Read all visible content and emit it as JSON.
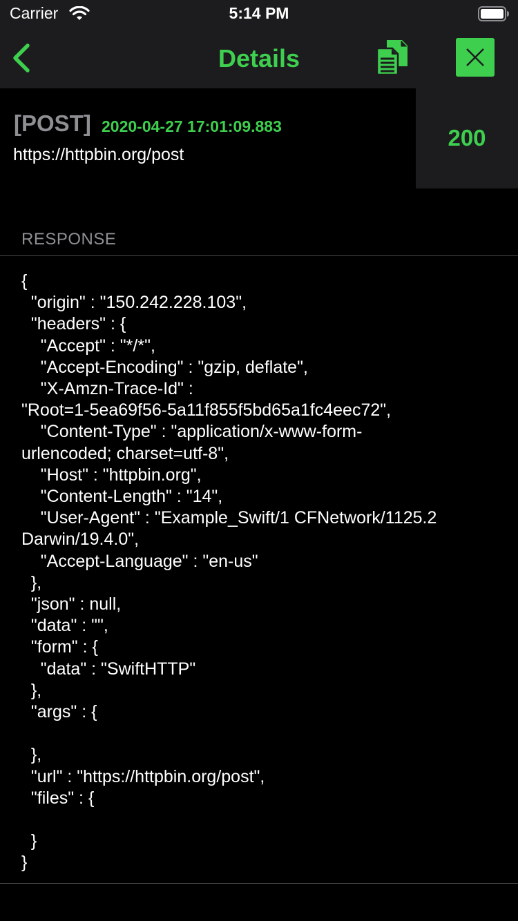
{
  "status_bar": {
    "carrier": "Carrier",
    "time": "5:14 PM"
  },
  "nav": {
    "title": "Details",
    "back_icon": "chevron-left-icon",
    "copy_icon": "copy-documents-icon",
    "close_icon": "close-x-icon"
  },
  "request": {
    "method": "[POST]",
    "timestamp": "2020-04-27 17:01:09.883",
    "url": "https://httpbin.org/post",
    "status_code": "200"
  },
  "response": {
    "section_title": "RESPONSE",
    "body": "{\n  \"origin\" : \"150.242.228.103\",\n  \"headers\" : {\n    \"Accept\" : \"*/*\",\n    \"Accept-Encoding\" : \"gzip, deflate\",\n    \"X-Amzn-Trace-Id\" :\n\"Root=1-5ea69f56-5a11f855f5bd65a1fc4eec72\",\n    \"Content-Type\" : \"application/x-www-form-\nurlencoded; charset=utf-8\",\n    \"Host\" : \"httpbin.org\",\n    \"Content-Length\" : \"14\",\n    \"User-Agent\" : \"Example_Swift/1 CFNetwork/1125.2\nDarwin/19.4.0\",\n    \"Accept-Language\" : \"en-us\"\n  },\n  \"json\" : null,\n  \"data\" : \"\",\n  \"form\" : {\n    \"data\" : \"SwiftHTTP\"\n  },\n  \"args\" : {\n\n  },\n  \"url\" : \"https://httpbin.org/post\",\n  \"files\" : {\n\n  }\n}"
  },
  "colors": {
    "accent": "#3ecf4f",
    "bar_background": "#1c1c1e",
    "background": "#000000",
    "muted_text": "#8e8e93"
  }
}
